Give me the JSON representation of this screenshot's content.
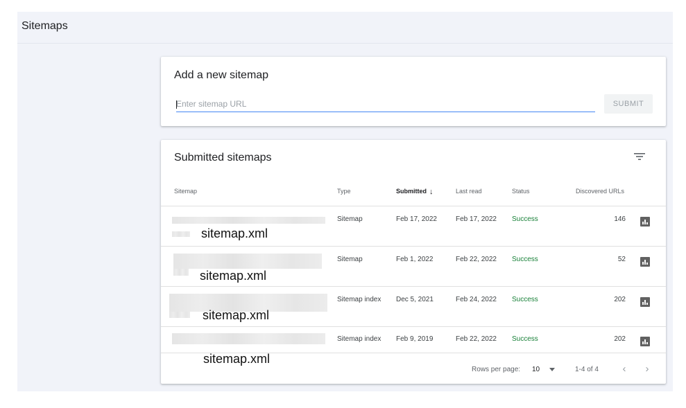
{
  "page": {
    "title": "Sitemaps"
  },
  "add_sitemap": {
    "title": "Add a new sitemap",
    "input_placeholder": "Enter sitemap URL",
    "input_value": "",
    "submit_label": "SUBMIT"
  },
  "submitted": {
    "title": "Submitted sitemaps",
    "filter_icon": "filter-icon",
    "columns": {
      "sitemap": "Sitemap",
      "type": "Type",
      "submitted": "Submitted",
      "last_read": "Last read",
      "status": "Status",
      "discovered": "Discovered URLs"
    },
    "rows": [
      {
        "sitemap": "sitemap.xml",
        "type": "Sitemap",
        "submitted": "Feb 17, 2022",
        "last_read": "Feb 17, 2022",
        "status": "Success",
        "discovered": "146"
      },
      {
        "sitemap": "sitemap.xml",
        "type": "Sitemap",
        "submitted": "Feb 1, 2022",
        "last_read": "Feb 22, 2022",
        "status": "Success",
        "discovered": "52"
      },
      {
        "sitemap": "sitemap.xml",
        "type": "Sitemap index",
        "submitted": "Dec 5, 2021",
        "last_read": "Feb 24, 2022",
        "status": "Success",
        "discovered": "202"
      },
      {
        "sitemap": "sitemap.xml",
        "type": "Sitemap index",
        "submitted": "Feb 9, 2019",
        "last_read": "Feb 22, 2022",
        "status": "Success",
        "discovered": "202"
      }
    ],
    "footer": {
      "rows_per_page_label": "Rows per page:",
      "rows_per_page_value": "10",
      "range": "1-4 of 4",
      "prev_icon": "chevron-left-icon",
      "next_icon": "chevron-right-icon"
    }
  },
  "colors": {
    "success": "#188038",
    "input_underline": "#4285f4",
    "background": "#f1f3f9"
  }
}
